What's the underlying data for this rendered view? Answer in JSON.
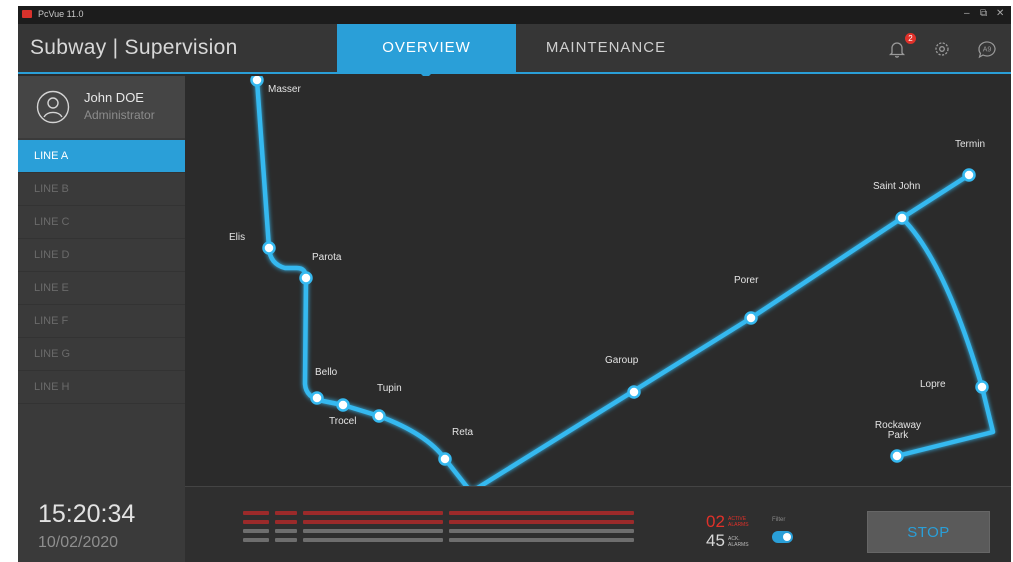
{
  "window": {
    "title": "PcVue 11.0",
    "controls": [
      "–",
      "⧉",
      "✕"
    ]
  },
  "header": {
    "brand": "Subway | Supervision",
    "tabs": [
      {
        "label": "OVERVIEW",
        "active": true
      },
      {
        "label": "MAINTENANCE",
        "active": false
      }
    ],
    "notification_count": "2",
    "icons": [
      "bell-icon",
      "gear-icon",
      "chat-icon"
    ],
    "chat_icon_text": "A9"
  },
  "user": {
    "name": "John DOE",
    "role": "Administrator"
  },
  "lines": [
    "LINE A",
    "LINE B",
    "LINE C",
    "LINE D",
    "LINE E",
    "LINE F",
    "LINE G",
    "LINE H"
  ],
  "active_line": "LINE A",
  "clock": {
    "time": "15:20:34",
    "date": "10/02/2020"
  },
  "stations": [
    {
      "name": "Masser"
    },
    {
      "name": "Elis"
    },
    {
      "name": "Parota"
    },
    {
      "name": "Bello"
    },
    {
      "name": "Trocel"
    },
    {
      "name": "Tupin"
    },
    {
      "name": "Reta"
    },
    {
      "name": "Garoup"
    },
    {
      "name": "Porer"
    },
    {
      "name": "Saint John"
    },
    {
      "name": "Termin"
    },
    {
      "name": "Lopre"
    },
    {
      "name": "Rockaway Park"
    }
  ],
  "alarms": {
    "active_count": "02",
    "active_label": "ACTIVE ALARMS",
    "ack_count": "45",
    "ack_label": "ACK. ALARMS",
    "filter_label": "Filter",
    "filter_on": true
  },
  "stop_button": "STOP",
  "colors": {
    "accent": "#2a9fd8",
    "line": "#35b6ee",
    "alarm": "#e0312a",
    "background": "#2b2b2b"
  }
}
